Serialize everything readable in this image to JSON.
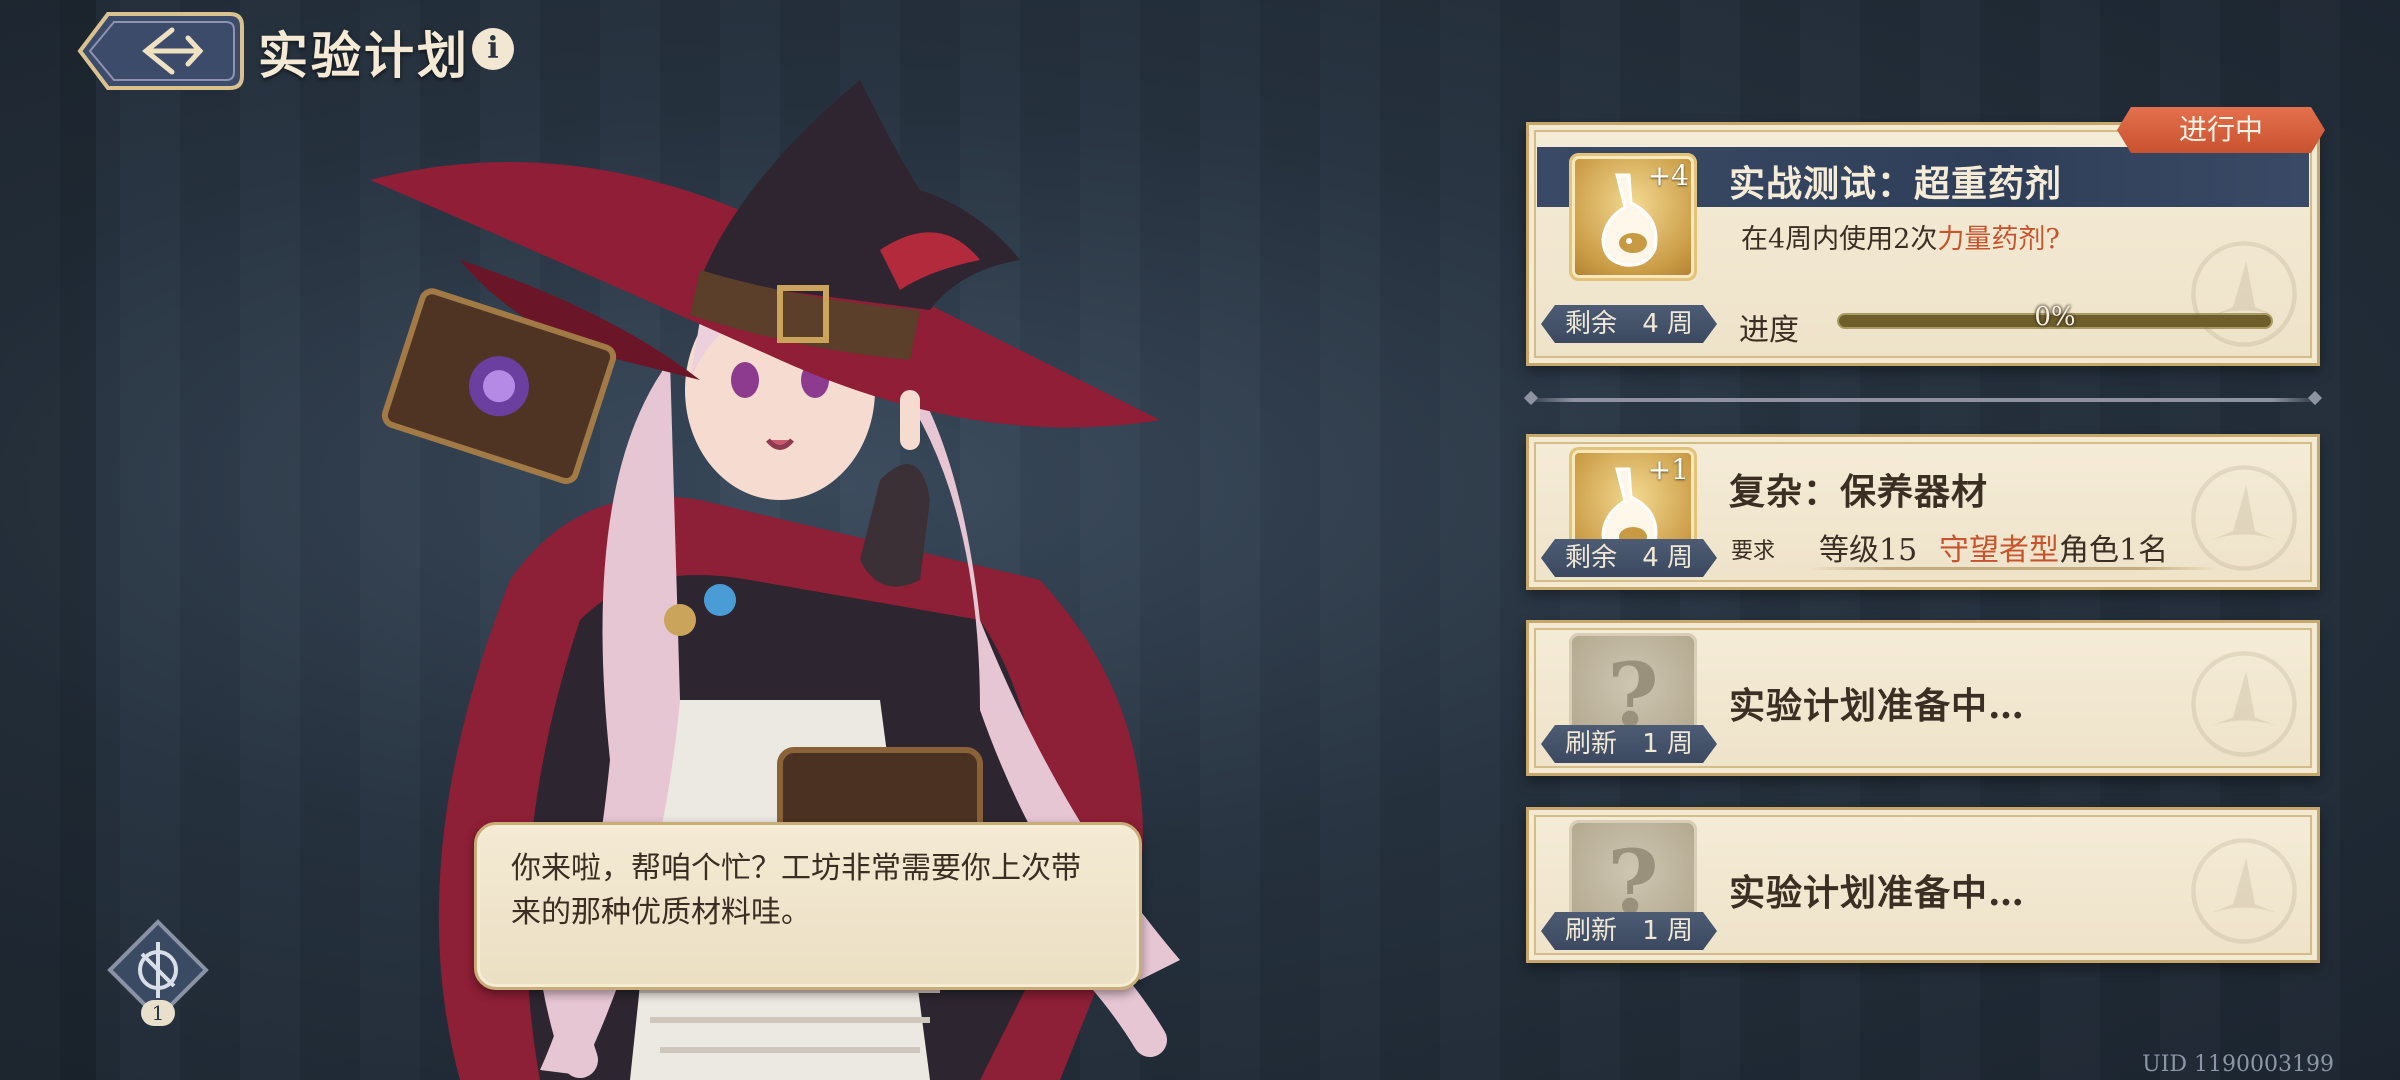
{
  "header": {
    "title": "实验计划",
    "info_glyph": "i"
  },
  "dialogue": {
    "text": "你来啦，帮咱个忙？工坊非常需要你上次带来的那种优质材料哇。"
  },
  "skill_badge": {
    "count": "1"
  },
  "plans": [
    {
      "status": "进行中",
      "title": "实战测试：超重药剂",
      "desc_prefix": "在4周内使用2次",
      "desc_highlight": "力量药剂?",
      "icon": "potion-icon",
      "icon_bonus": "+4",
      "remain_label": "剩余",
      "remain_value": "4 周",
      "progress_label": "进度",
      "progress_text": "0%",
      "progress_fraction": 0
    },
    {
      "title": "复杂：保养器材",
      "icon": "potion-icon",
      "icon_bonus": "+1",
      "remain_label": "剩余",
      "remain_value": "4 周",
      "req_label": "要求",
      "req_level": "等级15",
      "req_role_highlight": "守望者型",
      "req_role_suffix": "角色1名"
    },
    {
      "title": "实验计划准备中…",
      "icon": "question-icon",
      "remain_label": "刷新",
      "remain_value": "1 周"
    },
    {
      "title": "实验计划准备中…",
      "icon": "question-icon",
      "remain_label": "刷新",
      "remain_value": "1 周"
    }
  ],
  "footer": {
    "uid": "UID 1190003199"
  },
  "colors": {
    "accent": "#c8542e",
    "card_bg": "#f5ecd8",
    "band": "#3a4a66"
  }
}
